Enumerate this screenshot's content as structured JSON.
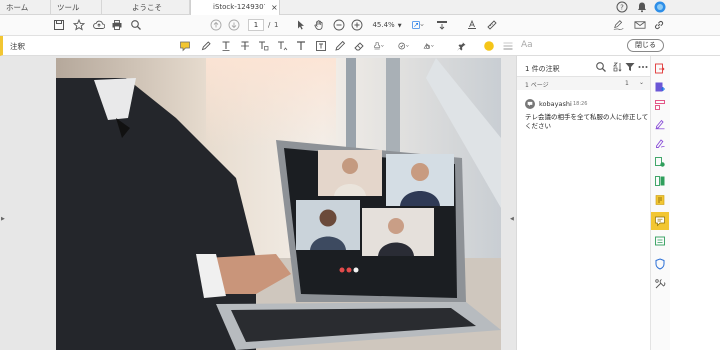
{
  "tabs": {
    "home": "ホーム",
    "tools": "ツール",
    "welcome": "ようこそ",
    "document": "iStock-1249307312",
    "close": "×"
  },
  "toolbar": {
    "page_current": "1",
    "page_sep": "/",
    "page_total": "1",
    "zoom": "45.4%"
  },
  "comment_bar": {
    "label": "注釈",
    "aa_label": "Aa",
    "close_button": "閉じる"
  },
  "panel": {
    "header": "1 件の注釈",
    "page_label": "1 ページ",
    "comment": {
      "author": "kobayashi",
      "time": "18:26",
      "text_line1": "テレ会議の相手を全て私服の人に修正して",
      "text_line2": "ください"
    }
  },
  "colors": {
    "accent_yellow": "#f2c632",
    "highlight_circle": "#f5c518",
    "comment_icon_bg": "#f2c632",
    "blue": "#1473e6"
  },
  "icons": [
    "save-icon",
    "star-icon",
    "upload-icon",
    "print-icon",
    "search-icon",
    "arrow-up-icon",
    "arrow-down-icon",
    "cursor-icon",
    "hand-icon",
    "zoom-out-icon",
    "zoom-in-icon",
    "fit-page-icon",
    "pen-sign-icon",
    "email-icon",
    "share-link-icon",
    "help-icon",
    "bell-icon",
    "avatar-icon"
  ]
}
